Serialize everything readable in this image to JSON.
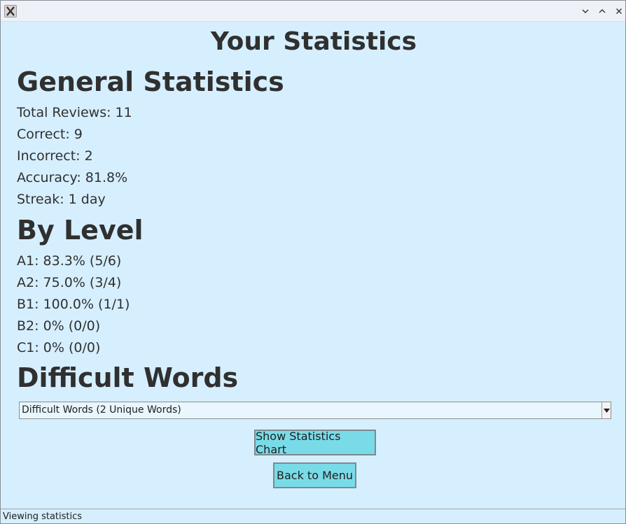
{
  "window": {
    "app_icon": "x-app-icon",
    "controls": [
      "minimize-icon",
      "maximize-icon",
      "close-icon"
    ]
  },
  "page_title": "Your Statistics",
  "general": {
    "heading": "General Statistics",
    "lines": [
      "Total Reviews: 11",
      "Correct: 9",
      "Incorrect: 2",
      "Accuracy: 81.8%",
      "Streak: 1 day"
    ]
  },
  "by_level": {
    "heading": "By Level",
    "lines": [
      "A1: 83.3% (5/6)",
      "A2: 75.0% (3/4)",
      "B1: 100.0% (1/1)",
      "B2: 0% (0/0)",
      "C1: 0% (0/0)"
    ]
  },
  "difficult": {
    "heading": "Difficult Words",
    "dropdown_value": "Difficult Words (2 Unique Words)"
  },
  "buttons": {
    "chart": "Show Statistics Chart",
    "back": "Back to Menu"
  },
  "status": "Viewing statistics",
  "colors": {
    "background": "#d6efff",
    "button": "#7adbe8",
    "text": "#303030"
  }
}
